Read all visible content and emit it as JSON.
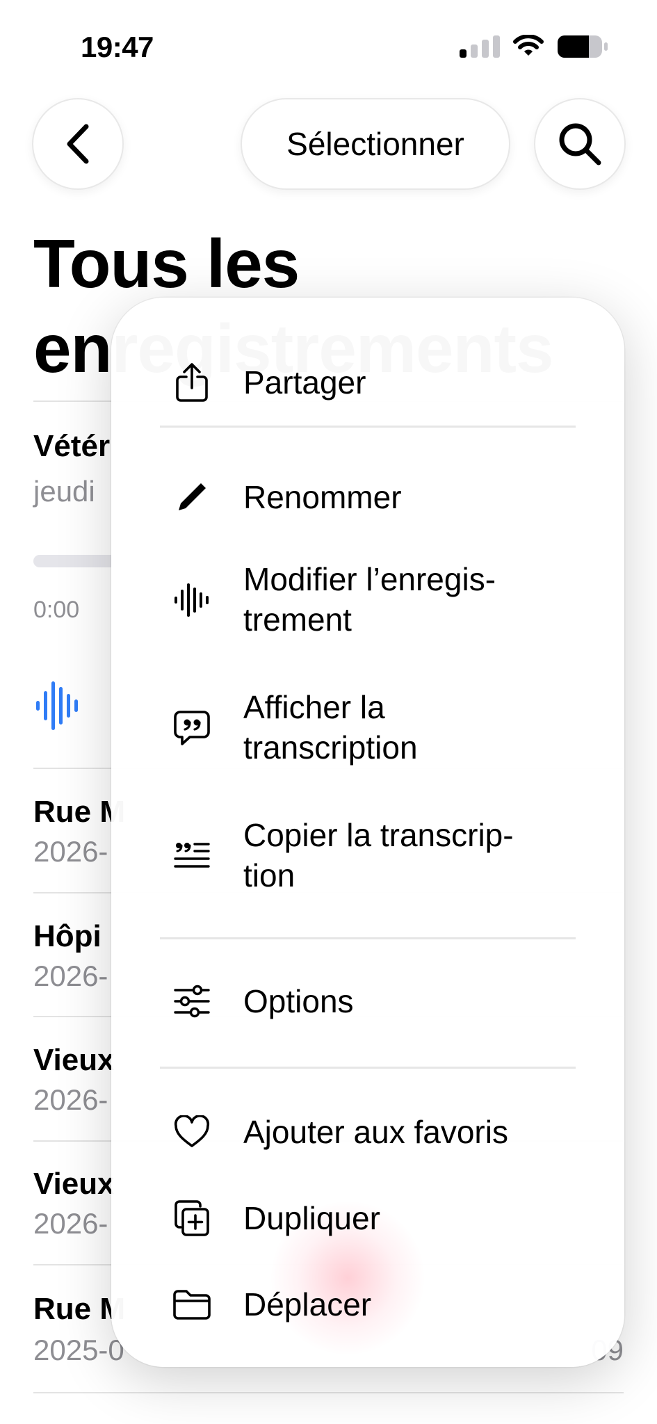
{
  "status_bar": {
    "time": "19:47",
    "icons": [
      "cellular-signal-icon",
      "wifi-icon",
      "battery-icon"
    ]
  },
  "nav": {
    "back_icon": "chevron-left-icon",
    "select_label": "Sélectionner",
    "search_icon": "search-icon"
  },
  "page": {
    "title": "Tous les enregistrements"
  },
  "recordings": [
    {
      "title": "Vétér",
      "subtitle": "jeudi",
      "expanded": true,
      "time_start": "0:00"
    },
    {
      "title": "Rue M",
      "subtitle": "2026-"
    },
    {
      "title": "Hôpi",
      "subtitle": "2026-"
    },
    {
      "title": "Vieux",
      "subtitle": "2026-"
    },
    {
      "title": "Vieux",
      "subtitle": "2026-"
    },
    {
      "title": "Rue M",
      "subtitle": "2025-0",
      "trailing": "09"
    }
  ],
  "menu": {
    "items": [
      {
        "label": "Partager",
        "icon": "share-icon"
      },
      {
        "label": "Renommer",
        "icon": "pencil-icon"
      },
      {
        "label": "Modifier l’enregis-\ntrement",
        "icon": "waveform-icon"
      },
      {
        "label": "Afficher la\ntranscription",
        "icon": "quote-bubble-icon"
      },
      {
        "label": "Copier la transcrip-\ntion",
        "icon": "quote-text-icon"
      },
      {
        "label": "Options",
        "icon": "sliders-icon"
      },
      {
        "label": "Ajouter aux favoris",
        "icon": "heart-icon"
      },
      {
        "label": "Dupliquer",
        "icon": "duplicate-icon"
      },
      {
        "label": "Déplacer",
        "icon": "folder-icon"
      }
    ]
  },
  "colors": {
    "accent_blue": "#2f7cf6",
    "secondary_text": "#8e8e93",
    "divider": "#e3e3e3"
  }
}
